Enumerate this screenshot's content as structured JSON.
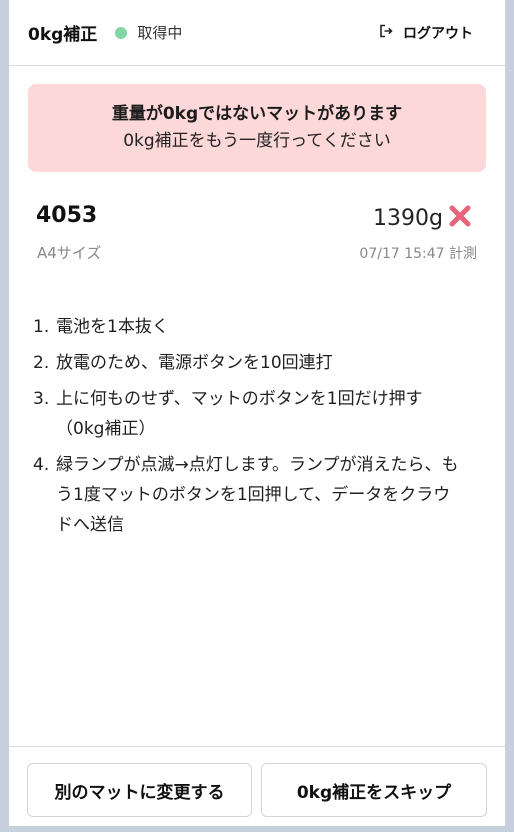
{
  "header": {
    "title": "0kg補正",
    "status": "取得中",
    "logout_label": "ログアウト"
  },
  "alert": {
    "title": "重量が0kgではないマットがあります",
    "message": "0kg補正をもう一度行ってください"
  },
  "mat": {
    "id": "4053",
    "size": "A4サイズ",
    "weight": "1390g",
    "measured_at": "07/17 15:47 計測"
  },
  "steps": [
    {
      "num": "1.",
      "text": "電池を1本抜く"
    },
    {
      "num": "2.",
      "text": "放電のため、電源ボタンを10回連打"
    },
    {
      "num": "3.",
      "text": "上に何ものせず、マットのボタンを1回だけ押す（0kg補正）"
    },
    {
      "num": "4.",
      "text": "緑ランプが点滅→点灯します。ランプが消えたら、もう1度マットのボタンを1回押して、データをクラウドへ送信"
    }
  ],
  "footer": {
    "change_label": "別のマットに変更する",
    "skip_label": "0kg補正をスキップ"
  },
  "colors": {
    "status_dot": "#82d6a6",
    "alert_background": "#fdd8d8",
    "error_icon": "#e8637a"
  },
  "icons": {
    "logout": "logout-icon",
    "error": "cross-mark-icon"
  }
}
